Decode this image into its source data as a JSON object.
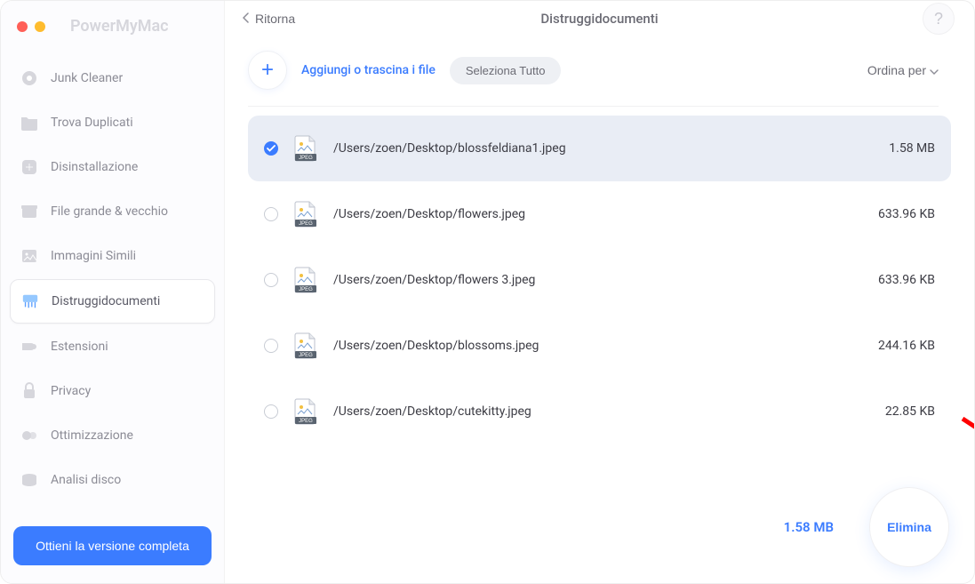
{
  "app_name": "PowerMyMac",
  "header": {
    "back": "Ritorna",
    "title": "Distruggidocumenti",
    "help": "?"
  },
  "sidebar": {
    "items": [
      {
        "label": "Junk Cleaner",
        "icon": "gear-icon"
      },
      {
        "label": "Trova Duplicati",
        "icon": "folder-icon"
      },
      {
        "label": "Disinstallazione",
        "icon": "app-icon"
      },
      {
        "label": "File grande & vecchio",
        "icon": "archive-icon"
      },
      {
        "label": "Immagini Simili",
        "icon": "image-icon"
      },
      {
        "label": "Distruggidocumenti",
        "icon": "shredder-icon",
        "active": true
      },
      {
        "label": "Estensioni",
        "icon": "extension-icon"
      },
      {
        "label": "Privacy",
        "icon": "lock-icon"
      },
      {
        "label": "Ottimizzazione",
        "icon": "optimize-icon"
      },
      {
        "label": "Analisi disco",
        "icon": "disk-icon"
      }
    ],
    "get_full": "Ottieni la versione completa"
  },
  "toolbar": {
    "add_label": "Aggiungi o trascina i file",
    "select_all": "Seleziona Tutto",
    "sort": "Ordina per"
  },
  "files": [
    {
      "path": "/Users/zoen/Desktop/blossfeldiana1.jpeg",
      "size": "1.58 MB",
      "selected": true
    },
    {
      "path": "/Users/zoen/Desktop/flowers.jpeg",
      "size": "633.96 KB",
      "selected": false
    },
    {
      "path": "/Users/zoen/Desktop/flowers 3.jpeg",
      "size": "633.96 KB",
      "selected": false
    },
    {
      "path": "/Users/zoen/Desktop/blossoms.jpeg",
      "size": "244.16 KB",
      "selected": false
    },
    {
      "path": "/Users/zoen/Desktop/cutekitty.jpeg",
      "size": "22.85 KB",
      "selected": false
    }
  ],
  "footer": {
    "total_size": "1.58 MB",
    "delete": "Elimina"
  }
}
